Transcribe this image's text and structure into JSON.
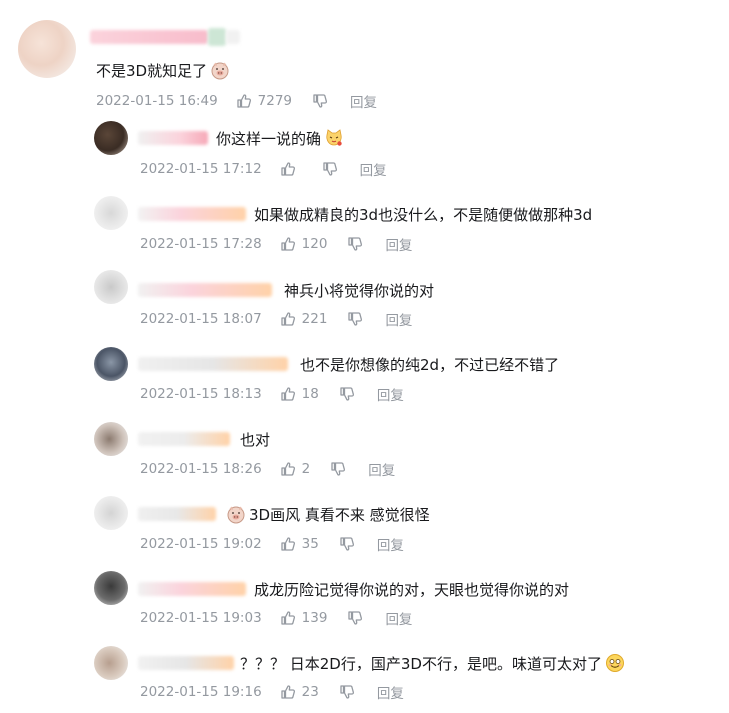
{
  "main_comment": {
    "text": "不是3D就知足了",
    "date": "2022-01-15 16:49",
    "likes": "7279",
    "reply_label": "回复"
  },
  "replies": [
    {
      "text": "你这样一说的确",
      "date": "2022-01-15 17:12",
      "likes": "",
      "reply_label": "回复"
    },
    {
      "text": "如果做成精良的3d也没什么，不是随便做做那种3d",
      "date": "2022-01-15 17:28",
      "likes": "120",
      "reply_label": "回复"
    },
    {
      "text": "神兵小将觉得你说的对",
      "date": "2022-01-15 18:07",
      "likes": "221",
      "reply_label": "回复"
    },
    {
      "text": "也不是你想像的纯2d，不过已经不错了",
      "date": "2022-01-15 18:13",
      "likes": "18",
      "reply_label": "回复"
    },
    {
      "text": "也对",
      "date": "2022-01-15 18:26",
      "likes": "2",
      "reply_label": "回复"
    },
    {
      "text": "3D画风 真看不来 感觉很怪",
      "date": "2022-01-15 19:02",
      "likes": "35",
      "reply_label": "回复"
    },
    {
      "text": "成龙历险记觉得你说的对，天眼也觉得你说的对",
      "date": "2022-01-15 19:03",
      "likes": "139",
      "reply_label": "回复"
    },
    {
      "text": "？？？ 日本2D行，国产3D不行，是吧。味道可太对了",
      "date": "2022-01-15 19:16",
      "likes": "23",
      "reply_label": "回复"
    }
  ],
  "icons": {
    "like": "thumbs-up-icon",
    "dislike": "thumbs-down-icon",
    "pig_emoji": "pig-face-emoji-icon",
    "cat_emoji": "cat-face-emoji-icon",
    "smile_emoji": "smiling-face-emoji-icon"
  },
  "colors": {
    "text": "#18191c",
    "meta": "#9499a0",
    "name_blur_pink": "#fbd3dc",
    "name_blur_orange": "#ffd2a8"
  }
}
